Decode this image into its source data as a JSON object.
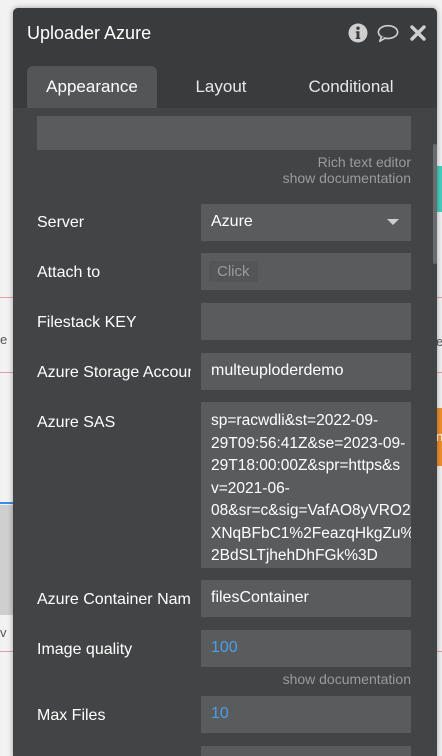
{
  "panel": {
    "title": "Uploader Azure",
    "tabs": [
      {
        "label": "Appearance",
        "active": true
      },
      {
        "label": "Layout",
        "active": false
      },
      {
        "label": "Conditional",
        "active": false
      }
    ]
  },
  "rich_text": {
    "label": "Rich text editor",
    "doc_link": "show documentation"
  },
  "rows": {
    "server": {
      "label": "Server",
      "value": "Azure"
    },
    "attach_to": {
      "label": "Attach to",
      "button": "Click"
    },
    "filestack_key": {
      "label": "Filestack KEY",
      "value": ""
    },
    "azure_storage": {
      "label": "Azure Storage Accoun",
      "value": "multeuploderdemo"
    },
    "azure_sas": {
      "label": "Azure SAS",
      "lines": [
        "sp=racwdli&st=2022-09-",
        "29T09:56:41Z&se=2023-09-",
        "29T18:00:00Z&spr=https&s",
        "v=2021-06-",
        "08&sr=c&sig=VafAO8yVRO2",
        "XNqBFbC1%2FeazqHkgZu%",
        "2BdSLTjhehDhFGk%3D"
      ]
    },
    "azure_container": {
      "label": "Azure Container Nam",
      "value": "filesContainer"
    },
    "image_quality": {
      "label": "Image quality",
      "value": "100",
      "doc_link": "show documentation"
    },
    "max_files": {
      "label": "Max Files",
      "value": "10"
    }
  },
  "background": {
    "left_text_1": "e",
    "left_text_2": "v",
    "right_text_1": "e",
    "right_text_2": "n"
  }
}
